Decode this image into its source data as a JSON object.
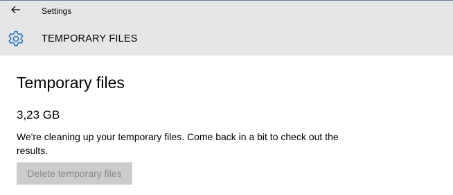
{
  "titlebar": {
    "back_icon": "back-arrow-icon",
    "title": "Settings"
  },
  "header": {
    "icon": "gear-icon",
    "title": "TEMPORARY FILES",
    "accent_color": "#2b78c2"
  },
  "main": {
    "page_title": "Temporary files",
    "size": "3,23 GB",
    "status_message": "We're cleaning up your temporary files. Come back in a bit to check out the results.",
    "delete_button_label": "Delete temporary files",
    "delete_button_enabled": false
  }
}
